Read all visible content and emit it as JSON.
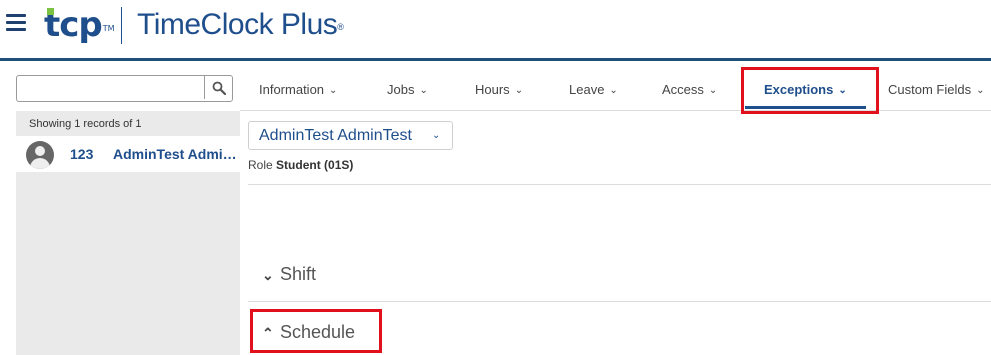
{
  "header": {
    "logo_short": "tcp",
    "logo_tm": "TM",
    "app_name": "TimeClock Plus",
    "app_reg": "®"
  },
  "search": {
    "value": "",
    "placeholder": ""
  },
  "records": {
    "showing": "Showing 1 records of 1",
    "items": [
      {
        "id": "123",
        "name": "AdminTest AdminTest"
      }
    ]
  },
  "tabs": [
    {
      "label": "Information",
      "active": false
    },
    {
      "label": "Jobs",
      "active": false
    },
    {
      "label": "Hours",
      "active": false
    },
    {
      "label": "Leave",
      "active": false
    },
    {
      "label": "Access",
      "active": false
    },
    {
      "label": "Exceptions",
      "active": true
    },
    {
      "label": "Custom Fields",
      "active": false
    }
  ],
  "employee": {
    "name": "AdminTest AdminTest",
    "role_label": "Role",
    "role_value": "Student (01S)"
  },
  "sections": [
    {
      "label": "Shift",
      "expanded": false
    },
    {
      "label": "Schedule",
      "expanded": true
    }
  ],
  "icons": {
    "menu": "hamburger-icon",
    "search": "search-icon",
    "tab_chevron": "chevron-down-icon",
    "section_collapsed": "chevron-down-icon",
    "section_expanded": "chevron-up-icon",
    "avatar": "user-avatar-icon"
  },
  "colors": {
    "brand_blue": "#1f4e8c",
    "brand_green": "#7cc242",
    "highlight_red": "#e0101c",
    "panel_gray": "#eaeaea"
  }
}
